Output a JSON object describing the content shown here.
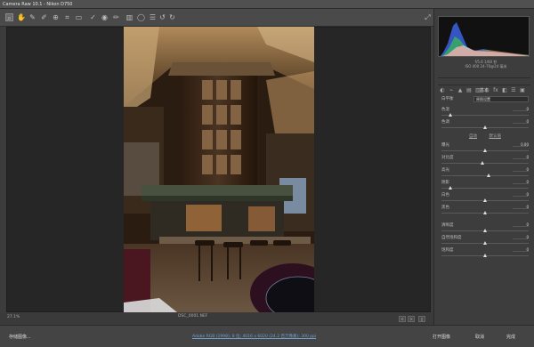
{
  "window": {
    "title": "Camera Raw 10.1 - Nikon D750"
  },
  "toolbar": {
    "tools": [
      "zoom-icon",
      "hand-icon",
      "white-balance-icon",
      "color-sampler-icon",
      "target-adjust-icon",
      "crop-icon",
      "straighten-icon",
      "spot-removal-icon",
      "red-eye-icon",
      "adjust-brush-icon",
      "graduated-filter-icon",
      "radial-filter-icon",
      "preferences-icon",
      "rotate-left-icon",
      "rotate-right-icon"
    ],
    "fullscreen_icon": "fullscreen-icon"
  },
  "panel": {
    "camera_info": [
      "f/5.6   1/60 秒",
      "ISO 400   24-70@24 毫米"
    ],
    "section_title": "基本",
    "white_balance": {
      "label": "白平衡",
      "value": "原照设置"
    },
    "sliders_group1": [
      {
        "label": "色温",
        "value": "0",
        "pos": 0.1
      },
      {
        "label": "色调",
        "value": "0",
        "pos": 0.5
      }
    ],
    "links": {
      "auto": "自动",
      "default": "默认值"
    },
    "sliders_group2": [
      {
        "label": "曝光",
        "value": "0.00",
        "pos": 0.5
      },
      {
        "label": "对比度",
        "value": "0",
        "pos": 0.47
      },
      {
        "label": "高光",
        "value": "0",
        "pos": 0.54
      },
      {
        "label": "阴影",
        "value": "0",
        "pos": 0.1
      },
      {
        "label": "白色",
        "value": "0",
        "pos": 0.5
      },
      {
        "label": "黑色",
        "value": "0",
        "pos": 0.5
      }
    ],
    "sliders_group3": [
      {
        "label": "清晰度",
        "value": "0",
        "pos": 0.5
      },
      {
        "label": "自然饱和度",
        "value": "0",
        "pos": 0.5
      },
      {
        "label": "饱和度",
        "value": "0",
        "pos": 0.5
      }
    ]
  },
  "status": {
    "zoom": "27.1%",
    "filename": "DSC_0001.NEF",
    "nav_prev": "<",
    "nav_next": ">"
  },
  "bottom": {
    "save": "存储图像...",
    "workflow": "Adobe RGB (1998); 8 位; 4016 x 6020 (24.2 百万像素); 300 ppi",
    "open": "打开图像",
    "cancel": "取消",
    "done": "完成"
  },
  "colors": {
    "panel_bg": "#3d3d3d",
    "canvas_bg": "#262626",
    "link_blue": "#6fa0d0"
  }
}
